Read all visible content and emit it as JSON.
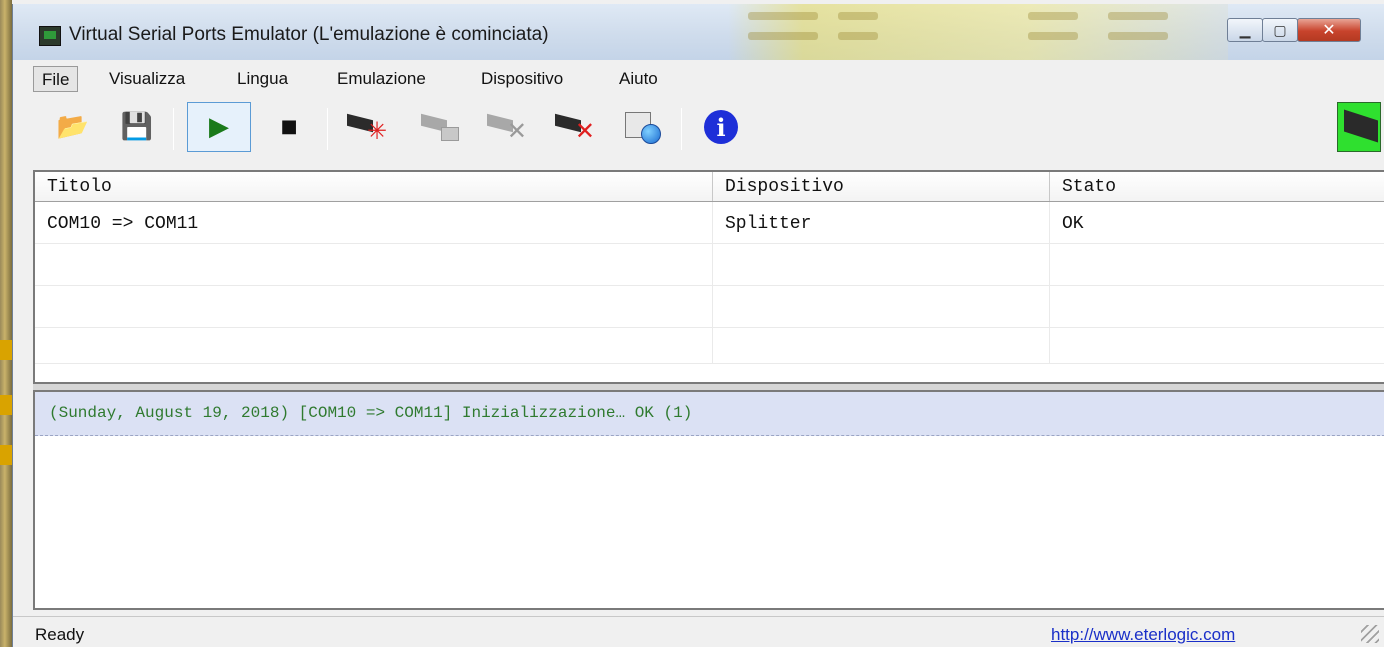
{
  "window": {
    "title": "Virtual Serial Ports Emulator (L'emulazione è cominciata)",
    "caption_buttons": [
      {
        "name": "minimize",
        "glyph": "▁"
      },
      {
        "name": "maximize",
        "glyph": "▢"
      },
      {
        "name": "close",
        "glyph": "✕"
      }
    ]
  },
  "menu": {
    "items": [
      "File",
      "Visualizza",
      "Lingua",
      "Emulazione",
      "Dispositivo",
      "Aiuto"
    ],
    "active": "File"
  },
  "toolbar": {
    "open_glyph": "📂",
    "save_glyph": "💾",
    "play_glyph": "▶",
    "stop_glyph": "■",
    "new_device_mark": "✳",
    "remove_device_mark": "✕",
    "info_glyph": "i"
  },
  "list": {
    "columns": [
      "Titolo",
      "Dispositivo",
      "Stato"
    ],
    "rows": [
      [
        "COM10 => COM11",
        "Splitter",
        "OK"
      ],
      [
        "",
        "",
        ""
      ],
      [
        "",
        "",
        ""
      ],
      [
        "",
        "",
        ""
      ]
    ]
  },
  "log": {
    "lines": [
      "(Sunday, August 19, 2018) [COM10 => COM11] Inizializzazione… OK (1)"
    ]
  },
  "status": {
    "text": "Ready",
    "link": "http://www.eterlogic.com"
  },
  "colors": {
    "log_text": "#2f7a2f",
    "log_highlight": "#dbe1f4",
    "link": "#1a2fc8",
    "info_icon": "#1e2fd8",
    "close_button": "#c8432c"
  }
}
